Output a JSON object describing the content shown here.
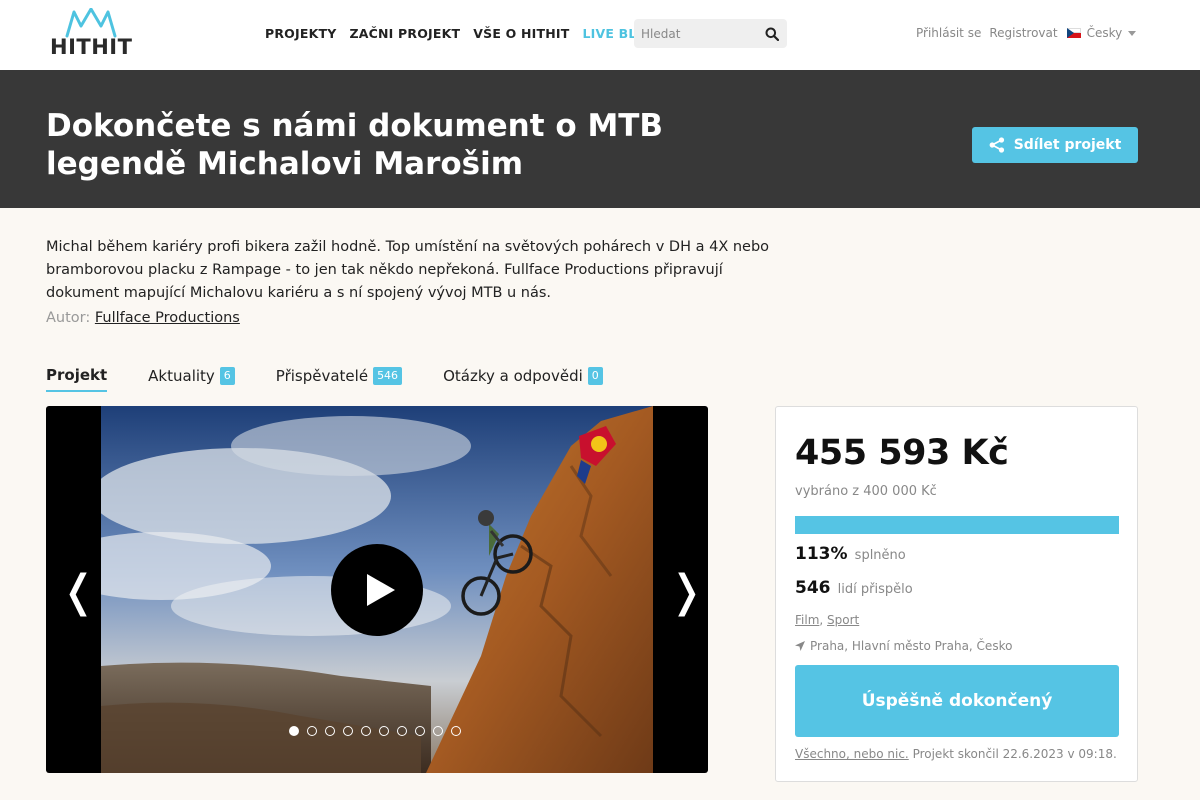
{
  "header": {
    "logo_text": "HITHIT",
    "nav": [
      {
        "label": "PROJEKTY"
      },
      {
        "label": "ZAČNI PROJEKT"
      },
      {
        "label": "VŠE O HITHIT"
      },
      {
        "label": "LIVE BLOG"
      }
    ],
    "search_placeholder": "Hledat",
    "login_label": "Přihlásit se",
    "register_label": "Registrovat",
    "language_label": "Česky"
  },
  "banner": {
    "title": "Dokončete s námi dokument o MTB legendě Michalovi Marošim",
    "share_label": "Sdílet projekt"
  },
  "project": {
    "description": "Michal během kariéry profi bikera zažil hodně. Top umístění na světových pohárech v DH a 4X nebo bramborovou placku z Rampage - to jen tak někdo nepřekoná. Fullface Productions připravují dokument mapující Michalovu kariéru a s ní spojený vývoj MTB u nás.",
    "author_prefix": "Autor:",
    "author_name": "Fullface Productions"
  },
  "tabs": [
    {
      "label": "Projekt",
      "count": ""
    },
    {
      "label": "Aktuality",
      "count": "6"
    },
    {
      "label": "Přispěvatelé",
      "count": "546"
    },
    {
      "label": "Otázky a odpovědi",
      "count": "0"
    }
  ],
  "gallery": {
    "prev_glyph": "❬",
    "next_glyph": "❭",
    "slide_count": 10,
    "active_slide": 1
  },
  "stats": {
    "amount": "455 593 Kč",
    "goal_text": "vybráno z 400 000 Kč",
    "progress_fraction": 1.0,
    "percent": "113%",
    "percent_label": "splněno",
    "backers": "546",
    "backers_label": "lidí přispělo",
    "category_1": "Film",
    "category_sep": ", ",
    "category_2": "Sport",
    "location": "Praha, Hlavní město Praha, Česko",
    "status_button": "Úspěšně dokončený",
    "all_or_nothing": "Všechno, nebo nic.",
    "ended_text": " Projekt skončil 22.6.2023 v 09:18."
  },
  "colors": {
    "accent": "#55c4e4",
    "banner_bg": "#383838",
    "page_bg": "#fbf8f3"
  }
}
